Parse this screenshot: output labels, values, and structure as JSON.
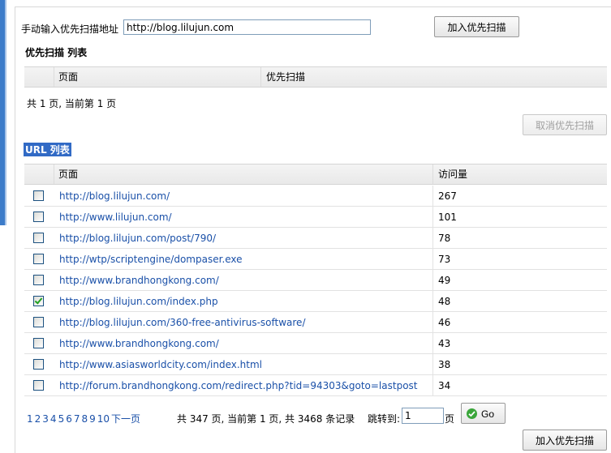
{
  "header": {
    "manual_label": "手动输入优先扫描地址",
    "url_value": "http://blog.lilujun.com",
    "add_button": "加入优先扫描"
  },
  "priority": {
    "title": "优先扫描 列表",
    "col_page": "页面",
    "col_priority": "优先扫描",
    "summary": "共 1 页, 当前第 1 页",
    "cancel_button": "取消优先扫描"
  },
  "url_list": {
    "title": "URL 列表",
    "col_page": "页面",
    "col_visits": "访问量",
    "rows": [
      {
        "url": "http://blog.lilujun.com/",
        "visits": "267",
        "checked": false
      },
      {
        "url": "http://www.lilujun.com/",
        "visits": "101",
        "checked": false
      },
      {
        "url": "http://blog.lilujun.com/post/790/",
        "visits": "78",
        "checked": false
      },
      {
        "url": "http://wtp/scriptengine/dompaser.exe",
        "visits": "73",
        "checked": false
      },
      {
        "url": "http://www.brandhongkong.com/",
        "visits": "49",
        "checked": false
      },
      {
        "url": "http://blog.lilujun.com/index.php",
        "visits": "48",
        "checked": true
      },
      {
        "url": "http://blog.lilujun.com/360-free-antivirus-software/",
        "visits": "46",
        "checked": false
      },
      {
        "url": "http://www.brandhongkong.com/",
        "visits": "43",
        "checked": false
      },
      {
        "url": "http://www.asiasworldcity.com/index.html",
        "visits": "38",
        "checked": false
      },
      {
        "url": "http://forum.brandhongkong.com/redirect.php?tid=94303&goto=lastpost",
        "visits": "34",
        "checked": false
      }
    ]
  },
  "pager": {
    "pages": [
      "1",
      "2",
      "3",
      "4",
      "5",
      "6",
      "7",
      "8",
      "9",
      "10"
    ],
    "next": "下一页",
    "summary": "共 347 页, 当前第 1 页, 共 3468 条记录",
    "jump_label": "跳转到:",
    "jump_value": "1",
    "jump_unit": "页",
    "go_button": "Go"
  },
  "footer": {
    "add_button": "加入优先扫描"
  },
  "colors": {
    "link": "#1a50a8",
    "highlight": "#316ac5",
    "go_icon": "#3aa63a"
  },
  "icons": {
    "go": "check-circle-icon"
  }
}
